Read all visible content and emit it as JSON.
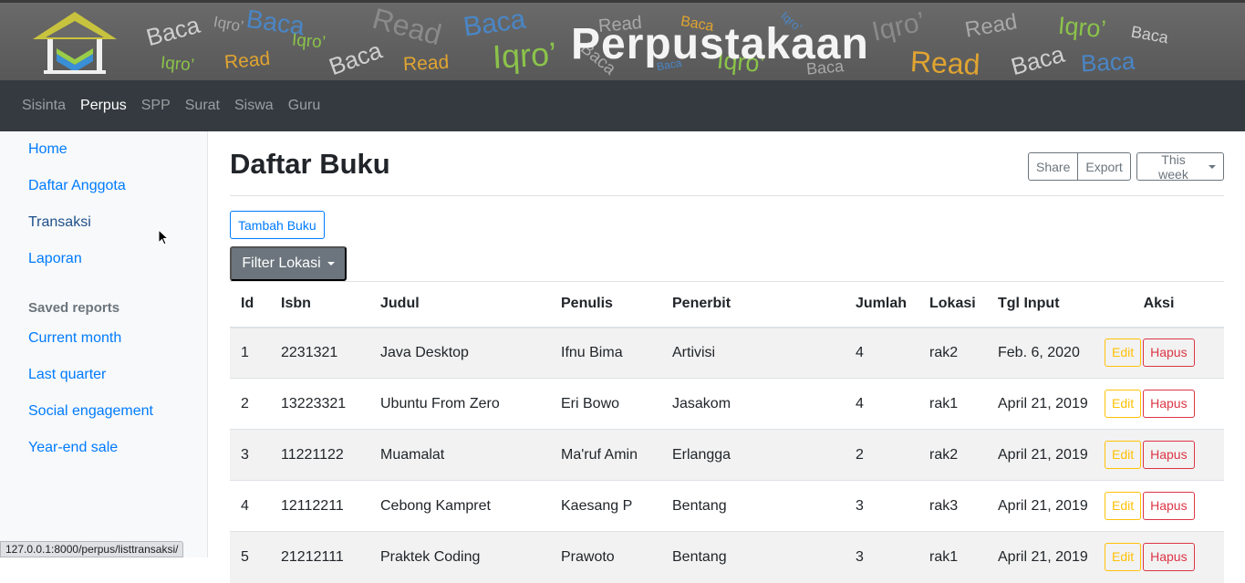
{
  "banner": {
    "title": "Perpustakaan",
    "decor_words": [
      "Baca",
      "Iqro’",
      "Baca",
      "Iqro’",
      "Iqro’",
      "Read",
      "Baca",
      "Read",
      "Baca",
      "Read",
      "Iqro’",
      "Baca",
      "Read",
      "Baca",
      "Iqro’",
      "Baca",
      "Iqro’",
      "Iqro’",
      "Read",
      "Baca",
      "Baca",
      "Read",
      "Iqro’",
      "Baca",
      "Baca",
      "Read",
      "Baca"
    ]
  },
  "topnav": {
    "items": [
      {
        "label": "Sisinta",
        "active": false
      },
      {
        "label": "Perpus",
        "active": true
      },
      {
        "label": "SPP",
        "active": false
      },
      {
        "label": "Surat",
        "active": false
      },
      {
        "label": "Siswa",
        "active": false
      },
      {
        "label": "Guru",
        "active": false
      }
    ]
  },
  "sidebar": {
    "items": [
      "Home",
      "Daftar Anggota",
      "Transaksi",
      "Laporan"
    ],
    "saved_heading": "Saved reports",
    "saved_items": [
      "Current month",
      "Last quarter",
      "Social engagement",
      "Year-end sale"
    ]
  },
  "main": {
    "title": "Daftar Buku",
    "share_label": "Share",
    "export_label": "Export",
    "period_label": "This week",
    "add_label": "Tambah Buku",
    "filter_label": "Filter Lokasi"
  },
  "table": {
    "headers": [
      "Id",
      "Isbn",
      "Judul",
      "Penulis",
      "Penerbit",
      "Jumlah",
      "Lokasi",
      "Tgl Input",
      "Aksi"
    ],
    "edit_label": "Edit",
    "delete_label": "Hapus",
    "rows": [
      [
        "1",
        "2231321",
        "Java Desktop",
        "Ifnu Bima",
        "Artivisi",
        "4",
        "rak2",
        "Feb. 6, 2020"
      ],
      [
        "2",
        "13223321",
        "Ubuntu From Zero",
        "Eri Bowo",
        "Jasakom",
        "4",
        "rak1",
        "April 21, 2019"
      ],
      [
        "3",
        "11221122",
        "Muamalat",
        "Ma'ruf Amin",
        "Erlangga",
        "2",
        "rak2",
        "April 21, 2019"
      ],
      [
        "4",
        "12112211",
        "Cebong Kampret",
        "Kaesang P",
        "Bentang",
        "3",
        "rak3",
        "April 21, 2019"
      ],
      [
        "5",
        "21212111",
        "Praktek Coding",
        "Prawoto",
        "Bentang",
        "3",
        "rak1",
        "April 21, 2019"
      ]
    ]
  },
  "statusbar": {
    "url": "127.0.0.1:8000/perpus/listtransaksi/"
  },
  "colors": {
    "link": "#007bff",
    "nav_bg": "#343a40",
    "edit": "#ffc107",
    "delete": "#dc3545"
  }
}
